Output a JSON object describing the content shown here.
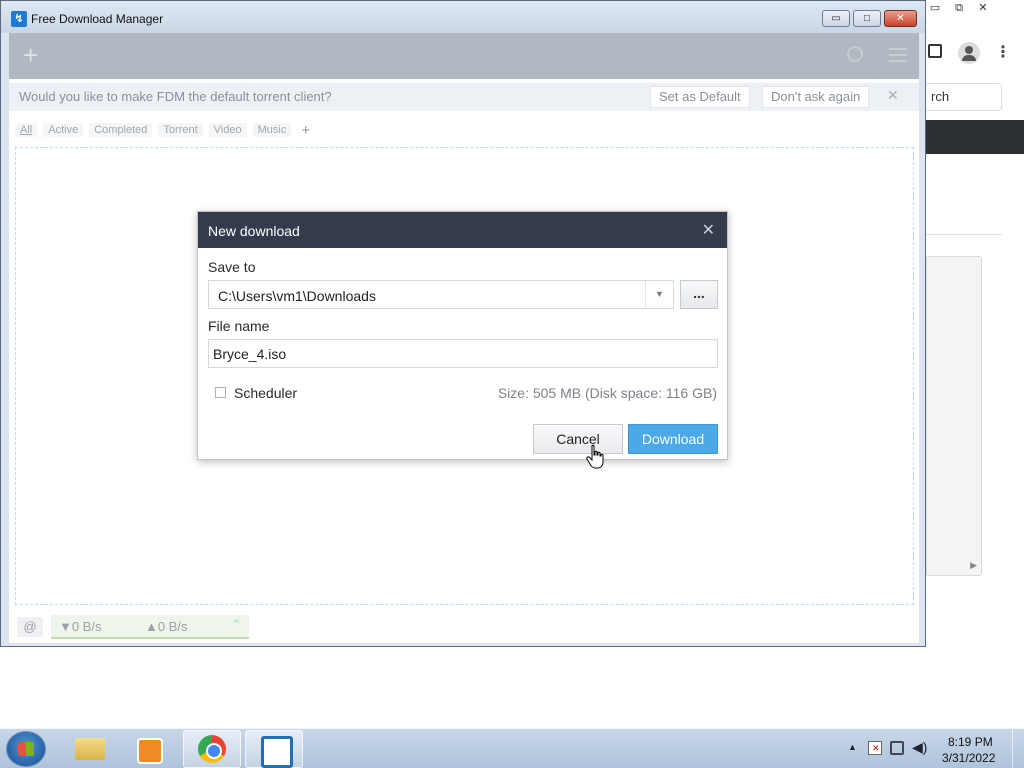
{
  "app": {
    "title": "Free Download Manager"
  },
  "window_controls": {
    "minimize": "▭",
    "maximize": "□",
    "close": "✕"
  },
  "toolbar": {
    "add": "+"
  },
  "torrent_banner": {
    "question": "Would you like to make FDM the default torrent client?",
    "set_default": "Set as Default",
    "dont_ask": "Don't ask again",
    "close": "✕"
  },
  "filter_tabs": [
    "All",
    "Active",
    "Completed",
    "Torrent",
    "Video",
    "Music"
  ],
  "add_tag": "+",
  "dialog": {
    "title": "New download",
    "close": "✕",
    "save_to_label": "Save to",
    "save_to_path": "C:\\Users\\vm1\\Downloads",
    "browse": "...",
    "file_name_label": "File name",
    "file_name": "Bryce_4.iso",
    "scheduler_label": "Scheduler",
    "size_info": "Size: 505 MB (Disk space: 116 GB)",
    "cancel": "Cancel",
    "download": "Download"
  },
  "status": {
    "down_speed": "▼0 B/s",
    "up_speed": "▲0 B/s",
    "collapse": "⌃"
  },
  "browser_bg": {
    "search_partial": "rch",
    "menu": "⋮"
  },
  "taskbar": {
    "time": "8:19 PM",
    "date": "3/31/2022"
  }
}
